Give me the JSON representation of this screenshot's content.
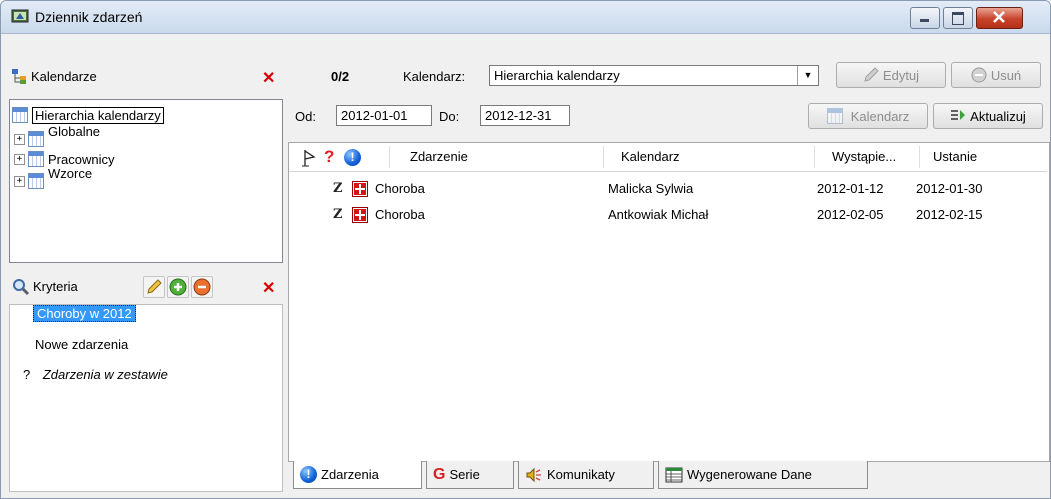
{
  "window": {
    "title": "Dziennik zdarzeń"
  },
  "calendars_panel": {
    "title": "Kalendarze",
    "items": [
      {
        "label": "Hierarchia kalendarzy",
        "selected": true
      },
      {
        "label": "Globalne"
      },
      {
        "label": "Pracownicy"
      },
      {
        "label": "Wzorce"
      }
    ]
  },
  "criteria_panel": {
    "title": "Kryteria",
    "items": [
      {
        "label": "Choroby w 2012",
        "selected": true
      },
      {
        "label": "Nowe zdarzenia"
      },
      {
        "prefix": "?",
        "label": "Zdarzenia w zestawie",
        "italic": true
      }
    ]
  },
  "toolbar": {
    "counter": "0/2",
    "calendar_label": "Kalendarz:",
    "calendar_value": "Hierarchia kalendarzy",
    "edit_label": "Edytuj",
    "delete_label": "Usuń",
    "from_label": "Od:",
    "from_value": "2012-01-01",
    "to_label": "Do:",
    "to_value": "2012-12-31",
    "calendar_button": "Kalendarz",
    "refresh_button": "Aktualizuj"
  },
  "grid": {
    "columns": [
      "Zdarzenie",
      "Kalendarz",
      "Wystąpie...",
      "Ustanie"
    ],
    "rows": [
      {
        "mark": "Z",
        "event": "Choroba",
        "calendar": "Malicka Sylwia",
        "start": "2012-01-12",
        "end": "2012-01-30"
      },
      {
        "mark": "Z",
        "event": "Choroba",
        "calendar": "Antkowiak Michał",
        "start": "2012-02-05",
        "end": "2012-02-15"
      }
    ]
  },
  "tabs": [
    "Zdarzenia",
    "Serie",
    "Komunikaty",
    "Wygenerowane Dane"
  ]
}
